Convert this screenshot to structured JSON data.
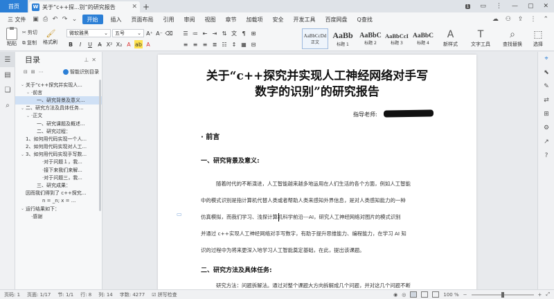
{
  "titlebar": {
    "home": "首页",
    "doc_tab_icon": "W",
    "doc_tab_title": "关于“c++探...别”的研究报告",
    "close_glyph": "✕",
    "new_tab": "+",
    "badge": "1",
    "controls": [
      "▭",
      "⋮",
      "—",
      "▢",
      "✕"
    ]
  },
  "menubar": {
    "file": "三 文件",
    "items": [
      "开始",
      "插入",
      "页面布局",
      "引用",
      "审阅",
      "视图",
      "章节",
      "加载项",
      "安全",
      "开发工具",
      "百度网盘",
      "Q查找"
    ],
    "active_index": 0
  },
  "ribbon": {
    "paste": "粘贴",
    "cut": "剪切",
    "copy": "复制",
    "format_painter": "格式刷",
    "font_family": "微软雅黑",
    "font_size": "五号",
    "styles": [
      {
        "sample": "AaBbCcDd",
        "label": "正文"
      },
      {
        "sample": "AaBb",
        "label": "标题 1"
      },
      {
        "sample": "AaBbC",
        "label": "标题 2"
      },
      {
        "sample": "AaBbCcI",
        "label": "标题 3"
      },
      {
        "sample": "AaBbC",
        "label": "标题 4"
      }
    ],
    "new_style": "新样式",
    "text_tools": "文字工具",
    "find_replace": "查找替换",
    "select": "选择"
  },
  "toc": {
    "title": "目录",
    "ai_label": "智能识别目录",
    "items": [
      {
        "text": "关于“c++探究并实现人...",
        "indent": 0,
        "caret": "⌄"
      },
      {
        "text": "·前言",
        "indent": 1,
        "caret": "⌄"
      },
      {
        "text": "一、研究背景及意义...",
        "indent": 2,
        "caret": "",
        "selected": true
      },
      {
        "text": "二、研究方法及具体任务...",
        "indent": 0,
        "caret": "⌄"
      },
      {
        "text": "·正文",
        "indent": 1,
        "caret": "⌄"
      },
      {
        "text": "一、研究课题及概述...",
        "indent": 2,
        "caret": ""
      },
      {
        "text": "二、研究过程：",
        "indent": 2,
        "caret": ""
      },
      {
        "text": "1、如何用代码实现一个人...",
        "indent": 0,
        "caret": ""
      },
      {
        "text": "2、如何用代码实现对人工...",
        "indent": 0,
        "caret": ""
      },
      {
        "text": "3、如何用代码实现手写数...",
        "indent": 0,
        "caret": "⌄"
      },
      {
        "text": "·对于问题１，我...",
        "indent": 3,
        "caret": ""
      },
      {
        "text": "·接下来我们来解...",
        "indent": 3,
        "caret": ""
      },
      {
        "text": "·对于问题三，我...",
        "indent": 3,
        "caret": ""
      },
      {
        "text": "三、研究成果：",
        "indent": 2,
        "caret": ""
      },
      {
        "text": "因而我们得到了 c++探究...",
        "indent": 0,
        "caret": ""
      },
      {
        "text": "n = _n; x = ...",
        "indent": 3,
        "caret": ""
      },
      {
        "text": "运行结果如下：",
        "indent": 0,
        "caret": "⌄"
      },
      {
        "text": "·感谢",
        "indent": 1,
        "caret": ""
      }
    ]
  },
  "document": {
    "title_line1": "关于“c++探究并实现人工神经网络对手写",
    "title_line2": "数字的识别”的研究报告",
    "advisor_label": "指导老师:",
    "heading_preface": "· 前言",
    "heading_bg": "一、研究背景及意义:",
    "para1": [
      "随着时代的不断演进，人工智能越来越多地运用在人们生活的各个方面，例如人工智能",
      "中的模式识别是指计算机代替人类或者帮助人类来感知外界信息，是对人类感知能力的一种",
      "仿真模拟，而我们学习、浅探计算机科学前沿---AI，研究人工神经网络对图片的模式识别",
      "并通过 c++实现人工神经网络对手写数字，有助于提升思维能力、编程能力，在学习 AI 知",
      "识的过程中为将来更深入地学习人工智能奠定基础，在此，提出该课题。"
    ],
    "heading_method": "二、研究方法及具体任务:",
    "para2": "研究方法：问题拆解法。通过对整个课题大方向拆解成几个问题，并对这几个问题不断"
  },
  "statusbar": {
    "page_no": "页码: 1",
    "page": "页面: 1/17",
    "section": "节: 1/1",
    "row": "行: 8",
    "col": "列: 14",
    "words": "字数: 4277",
    "spell": "拼写检查",
    "zoom": "100 %",
    "zoom_fraction": 0.5
  }
}
